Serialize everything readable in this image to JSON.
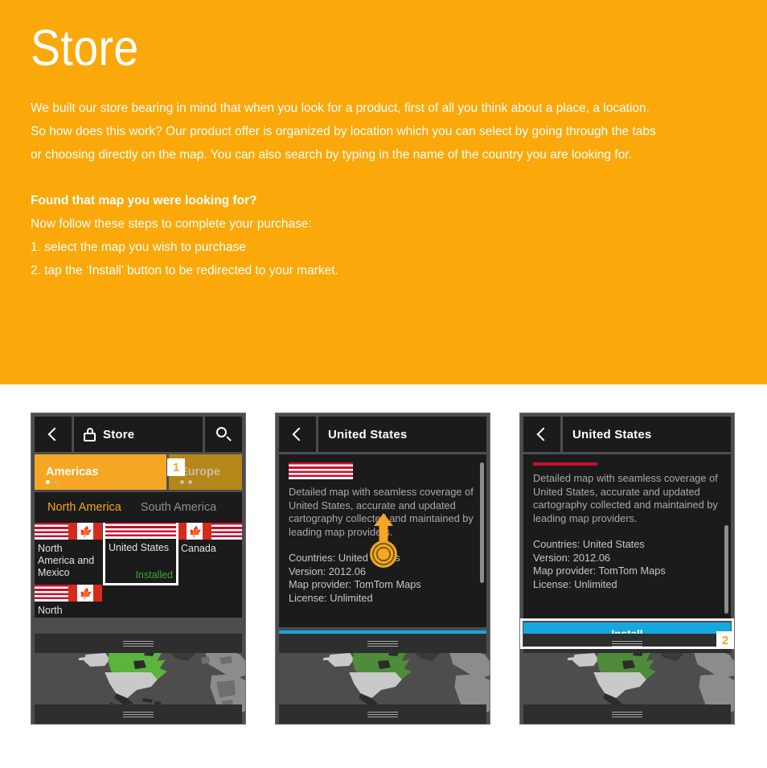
{
  "hero": {
    "title": "Store",
    "paragraph_lines": [
      "We built our store bearing in mind that when you look for a product, first of all you think about a place, a location.",
      "So how does this work? Our product offer is organized by location which you can select by going through the tabs",
      "or choosing directly on the map. You can also search by typing in the name of the country you are looking for."
    ],
    "subheading": "Found that map you were looking for?",
    "intro": "Now follow these steps to complete your purchase:",
    "steps": [
      "1. select the map you wish to purchase",
      "2. tap the ‘Install’ button to be redirected to your market."
    ],
    "bg_color": "#FAA80A",
    "text_color": "#FFFFFF"
  },
  "phone1": {
    "titlebar": {
      "back_icon": "chevron-left-icon",
      "lock_icon": "lock-icon",
      "title": "Store",
      "search_icon": "search-icon"
    },
    "region_tabs": [
      {
        "label": "Americas",
        "selected": true,
        "dots": 2,
        "active_dot": 1
      },
      {
        "label": "Europe",
        "selected": false,
        "dots": 2,
        "active_dot": 0
      }
    ],
    "sub_tabs": [
      {
        "label": "North America",
        "active": true
      },
      {
        "label": "South America",
        "active": false
      }
    ],
    "tiles": [
      {
        "name": "North America and Mexico",
        "flags": [
          "us",
          "ca",
          "mx"
        ],
        "status": ""
      },
      {
        "name": "United States",
        "flags": [
          "us"
        ],
        "status": "Installed",
        "selected": true
      },
      {
        "name": "Canada",
        "flags": [
          "ca"
        ],
        "status": ""
      },
      {
        "name": "North",
        "flags": [
          "us",
          "ca"
        ],
        "status": ""
      }
    ],
    "badge": "1",
    "status_color": "#3AA832",
    "accent_color": "#F5A623"
  },
  "phone2": {
    "titlebar": {
      "back_icon": "chevron-left-icon",
      "title": "United States"
    },
    "flag": "us",
    "description": "Detailed map with seamless coverage of United States, accurate and updated cartography collected and maintained by leading map providers.",
    "meta": [
      "Countries: United States",
      "Version: 2012.06",
      "Map provider: TomTom Maps",
      "License: Unlimited"
    ],
    "gesture": "swipe-up-gesture",
    "install_label": ""
  },
  "phone3": {
    "titlebar": {
      "back_icon": "chevron-left-icon",
      "title": "United States"
    },
    "description": "Detailed map with seamless coverage of United States, accurate and updated cartography collected and maintained by leading map providers.",
    "meta": [
      "Countries: United States",
      "Version: 2012.06",
      "Map provider: TomTom Maps",
      "License: Unlimited"
    ],
    "install_label": "Install",
    "install_color": "#17A7E0",
    "badge": "2"
  },
  "map": {
    "highlight_color": "#5CB33E",
    "land_color": "#2b2b2b",
    "selected_color": "#d4d4d4",
    "ocean_color": "#4d4d4d"
  }
}
